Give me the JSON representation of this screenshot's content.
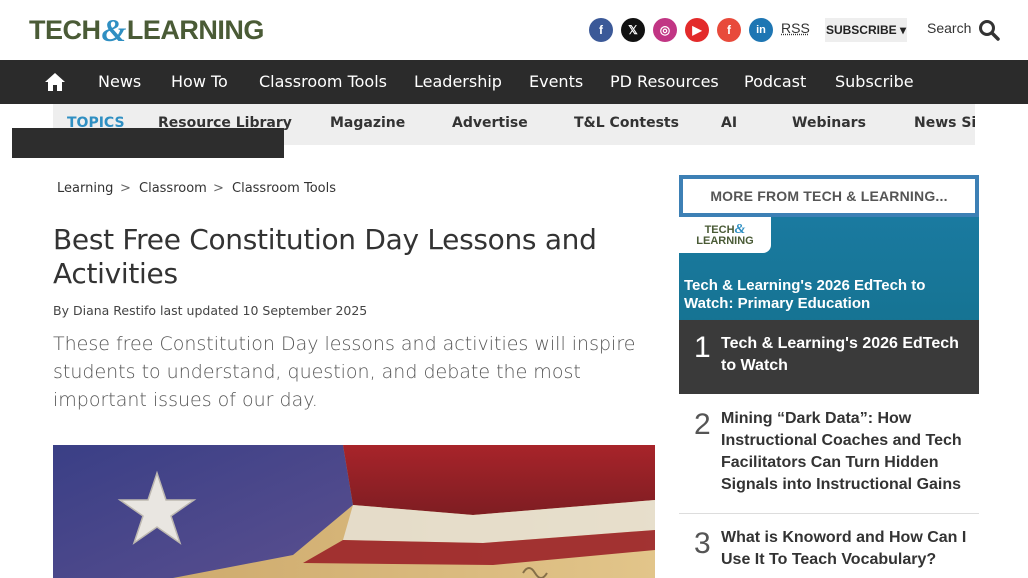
{
  "header": {
    "logo_left": "TECH",
    "logo_amp": "&",
    "logo_right": "LEARNING",
    "social": [
      {
        "icon": "facebook-icon",
        "glyph": "f"
      },
      {
        "icon": "x-twitter-icon",
        "glyph": "𝕏"
      },
      {
        "icon": "instagram-icon",
        "glyph": "◎"
      },
      {
        "icon": "youtube-icon",
        "glyph": "▶"
      },
      {
        "icon": "flipboard-icon",
        "glyph": "f"
      },
      {
        "icon": "linkedin-icon",
        "glyph": "in"
      }
    ],
    "rss_label": "RSS",
    "subscribe_label": "SUBSCRIBE ▾",
    "search_label": "Search"
  },
  "nav": {
    "items": [
      "News",
      "How To",
      "Classroom Tools",
      "Leadership",
      "Events",
      "PD Resources",
      "Podcast",
      "Subscribe"
    ]
  },
  "topics": {
    "lead": "Topics",
    "items": [
      "Resource Library",
      "Magazine",
      "Advertise",
      "T&L Contests",
      "AI",
      "Webinars",
      "News Sign"
    ]
  },
  "breadcrumb": {
    "items": [
      "Learning",
      "Classroom",
      "Classroom Tools"
    ],
    "separator": ">"
  },
  "article": {
    "title": "Best Free Constitution Day Lessons and Activities",
    "byline_prefix": "By",
    "author": "Diana Restifo",
    "updated": "last updated 10 September 2025",
    "standfirst": "These free Constitution Day lessons and activities will inspire students to understand, question, and debate the most important issues of our day."
  },
  "sidebar": {
    "heading": "MORE FROM TECH & LEARNING...",
    "feature_logo_top": "TECH",
    "feature_logo_amp": "&",
    "feature_logo_bottom": "LEARNING",
    "feature_headline": "Tech & Learning's 2026 EdTech to Watch: Primary Education",
    "stories": [
      {
        "rank": "1",
        "title": "Tech & Learning's 2026 EdTech to Watch"
      },
      {
        "rank": "2",
        "title": "Mining “Dark Data”: How Instructional Coaches and Tech Facilitators Can Turn Hidden Signals into Instructional Gains"
      },
      {
        "rank": "3",
        "title": "What is Knoword and How Can I Use It To Teach Vocabulary?"
      }
    ]
  },
  "colors": {
    "nav_bg": "#2b2b2b",
    "accent_blue": "#2f8fc2",
    "logo_green": "#4a5b36",
    "box_border": "#3d80b5"
  }
}
